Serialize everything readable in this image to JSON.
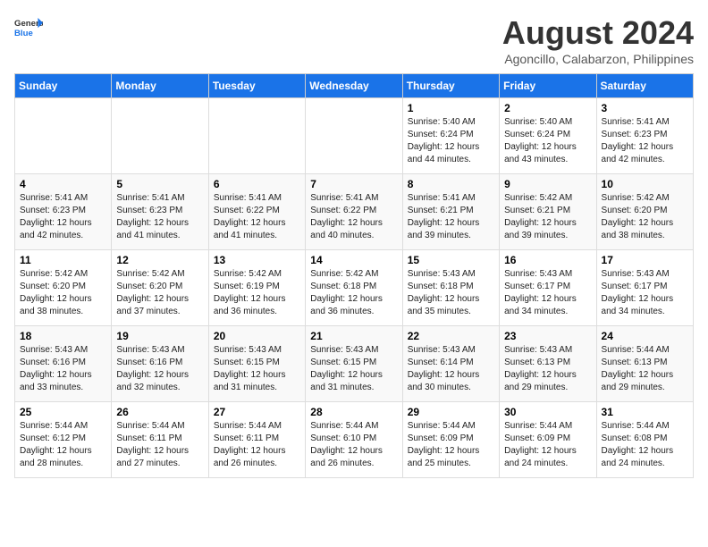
{
  "logo": {
    "line1": "General",
    "line2": "Blue"
  },
  "title": "August 2024",
  "subtitle": "Agoncillo, Calabarzon, Philippines",
  "days_of_week": [
    "Sunday",
    "Monday",
    "Tuesday",
    "Wednesday",
    "Thursday",
    "Friday",
    "Saturday"
  ],
  "weeks": [
    [
      {
        "day": "",
        "info": ""
      },
      {
        "day": "",
        "info": ""
      },
      {
        "day": "",
        "info": ""
      },
      {
        "day": "",
        "info": ""
      },
      {
        "day": "1",
        "info": "Sunrise: 5:40 AM\nSunset: 6:24 PM\nDaylight: 12 hours\nand 44 minutes."
      },
      {
        "day": "2",
        "info": "Sunrise: 5:40 AM\nSunset: 6:24 PM\nDaylight: 12 hours\nand 43 minutes."
      },
      {
        "day": "3",
        "info": "Sunrise: 5:41 AM\nSunset: 6:23 PM\nDaylight: 12 hours\nand 42 minutes."
      }
    ],
    [
      {
        "day": "4",
        "info": "Sunrise: 5:41 AM\nSunset: 6:23 PM\nDaylight: 12 hours\nand 42 minutes."
      },
      {
        "day": "5",
        "info": "Sunrise: 5:41 AM\nSunset: 6:23 PM\nDaylight: 12 hours\nand 41 minutes."
      },
      {
        "day": "6",
        "info": "Sunrise: 5:41 AM\nSunset: 6:22 PM\nDaylight: 12 hours\nand 41 minutes."
      },
      {
        "day": "7",
        "info": "Sunrise: 5:41 AM\nSunset: 6:22 PM\nDaylight: 12 hours\nand 40 minutes."
      },
      {
        "day": "8",
        "info": "Sunrise: 5:41 AM\nSunset: 6:21 PM\nDaylight: 12 hours\nand 39 minutes."
      },
      {
        "day": "9",
        "info": "Sunrise: 5:42 AM\nSunset: 6:21 PM\nDaylight: 12 hours\nand 39 minutes."
      },
      {
        "day": "10",
        "info": "Sunrise: 5:42 AM\nSunset: 6:20 PM\nDaylight: 12 hours\nand 38 minutes."
      }
    ],
    [
      {
        "day": "11",
        "info": "Sunrise: 5:42 AM\nSunset: 6:20 PM\nDaylight: 12 hours\nand 38 minutes."
      },
      {
        "day": "12",
        "info": "Sunrise: 5:42 AM\nSunset: 6:20 PM\nDaylight: 12 hours\nand 37 minutes."
      },
      {
        "day": "13",
        "info": "Sunrise: 5:42 AM\nSunset: 6:19 PM\nDaylight: 12 hours\nand 36 minutes."
      },
      {
        "day": "14",
        "info": "Sunrise: 5:42 AM\nSunset: 6:18 PM\nDaylight: 12 hours\nand 36 minutes."
      },
      {
        "day": "15",
        "info": "Sunrise: 5:43 AM\nSunset: 6:18 PM\nDaylight: 12 hours\nand 35 minutes."
      },
      {
        "day": "16",
        "info": "Sunrise: 5:43 AM\nSunset: 6:17 PM\nDaylight: 12 hours\nand 34 minutes."
      },
      {
        "day": "17",
        "info": "Sunrise: 5:43 AM\nSunset: 6:17 PM\nDaylight: 12 hours\nand 34 minutes."
      }
    ],
    [
      {
        "day": "18",
        "info": "Sunrise: 5:43 AM\nSunset: 6:16 PM\nDaylight: 12 hours\nand 33 minutes."
      },
      {
        "day": "19",
        "info": "Sunrise: 5:43 AM\nSunset: 6:16 PM\nDaylight: 12 hours\nand 32 minutes."
      },
      {
        "day": "20",
        "info": "Sunrise: 5:43 AM\nSunset: 6:15 PM\nDaylight: 12 hours\nand 31 minutes."
      },
      {
        "day": "21",
        "info": "Sunrise: 5:43 AM\nSunset: 6:15 PM\nDaylight: 12 hours\nand 31 minutes."
      },
      {
        "day": "22",
        "info": "Sunrise: 5:43 AM\nSunset: 6:14 PM\nDaylight: 12 hours\nand 30 minutes."
      },
      {
        "day": "23",
        "info": "Sunrise: 5:43 AM\nSunset: 6:13 PM\nDaylight: 12 hours\nand 29 minutes."
      },
      {
        "day": "24",
        "info": "Sunrise: 5:44 AM\nSunset: 6:13 PM\nDaylight: 12 hours\nand 29 minutes."
      }
    ],
    [
      {
        "day": "25",
        "info": "Sunrise: 5:44 AM\nSunset: 6:12 PM\nDaylight: 12 hours\nand 28 minutes."
      },
      {
        "day": "26",
        "info": "Sunrise: 5:44 AM\nSunset: 6:11 PM\nDaylight: 12 hours\nand 27 minutes."
      },
      {
        "day": "27",
        "info": "Sunrise: 5:44 AM\nSunset: 6:11 PM\nDaylight: 12 hours\nand 26 minutes."
      },
      {
        "day": "28",
        "info": "Sunrise: 5:44 AM\nSunset: 6:10 PM\nDaylight: 12 hours\nand 26 minutes."
      },
      {
        "day": "29",
        "info": "Sunrise: 5:44 AM\nSunset: 6:09 PM\nDaylight: 12 hours\nand 25 minutes."
      },
      {
        "day": "30",
        "info": "Sunrise: 5:44 AM\nSunset: 6:09 PM\nDaylight: 12 hours\nand 24 minutes."
      },
      {
        "day": "31",
        "info": "Sunrise: 5:44 AM\nSunset: 6:08 PM\nDaylight: 12 hours\nand 24 minutes."
      }
    ]
  ]
}
